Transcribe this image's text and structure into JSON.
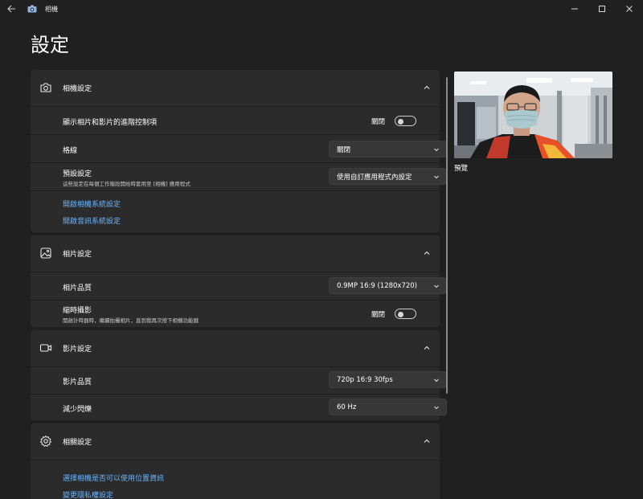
{
  "titlebar": {
    "app_title": "相機",
    "back_icon": "back-arrow-icon",
    "minimize_icon": "minimize-icon",
    "maximize_icon": "maximize-icon",
    "close_icon": "close-icon"
  },
  "page": {
    "title": "設定"
  },
  "camera_settings": {
    "title": "相機設定",
    "icon": "camera-icon",
    "advanced_controls": {
      "label": "顯示相片和影片的進階控制項",
      "state": "關閉"
    },
    "gridlines": {
      "label": "格線",
      "value": "關閉"
    },
    "default_settings": {
      "label": "預設設定",
      "description": "這些設定在每個工作階段開始時套用至 [相機] 應用程式",
      "value": "使用自訂應用程式內設定"
    },
    "links": [
      "開啟相機系統設定",
      "開啟音訊系統設定"
    ]
  },
  "photo_settings": {
    "title": "相片設定",
    "icon": "photo-icon",
    "photo_quality": {
      "label": "相片品質",
      "value": "0.9MP 16:9 (1280x720)"
    },
    "timelapse": {
      "label": "縮時攝影",
      "description": "開啟計時器時，繼續拍攝相片，直到我再次按下相機功能鍵",
      "state": "關閉"
    }
  },
  "video_settings": {
    "title": "影片設定",
    "icon": "video-icon",
    "video_quality": {
      "label": "影片品質",
      "value": "720p 16:9 30fps"
    },
    "flicker_reduction": {
      "label": "減少閃爍",
      "value": "60 Hz"
    }
  },
  "related_settings": {
    "title": "相關設定",
    "icon": "gear-icon",
    "links": [
      "選擇相機是否可以使用位置資訊",
      "變更隱私權設定"
    ]
  },
  "preview": {
    "label": "預覽"
  },
  "colors": {
    "background": "#202020",
    "panel": "#2b2b2b",
    "link": "#6ab4ff",
    "dropdown": "#373737"
  }
}
